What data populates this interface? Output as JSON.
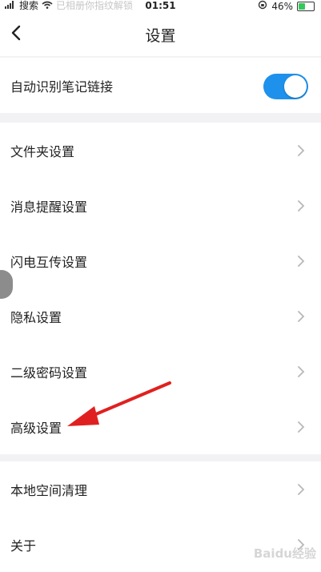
{
  "status_bar": {
    "carrier": "搜索",
    "ghost_text": "已相册你指纹解锁",
    "time": "01:51",
    "battery": "46%",
    "battery_level": 0.46
  },
  "nav": {
    "back_icon": "chevron-left-icon",
    "title": "设置"
  },
  "groups": [
    {
      "items": [
        {
          "label": "自动识别笔记链接",
          "toggle_on": true
        }
      ]
    },
    {
      "items": [
        {
          "label": "文件夹设置"
        },
        {
          "label": "消息提醒设置"
        },
        {
          "label": "闪电互传设置"
        },
        {
          "label": "隐私设置"
        },
        {
          "label": "二级密码设置"
        },
        {
          "label": "高级设置"
        }
      ]
    },
    {
      "items": [
        {
          "label": "本地空间清理"
        },
        {
          "label": "关于"
        }
      ]
    }
  ],
  "colors": {
    "accent": "#1e91ec",
    "annotation_arrow": "#e02020",
    "background": "#f2f2f4"
  },
  "watermark": "Baidu经验"
}
